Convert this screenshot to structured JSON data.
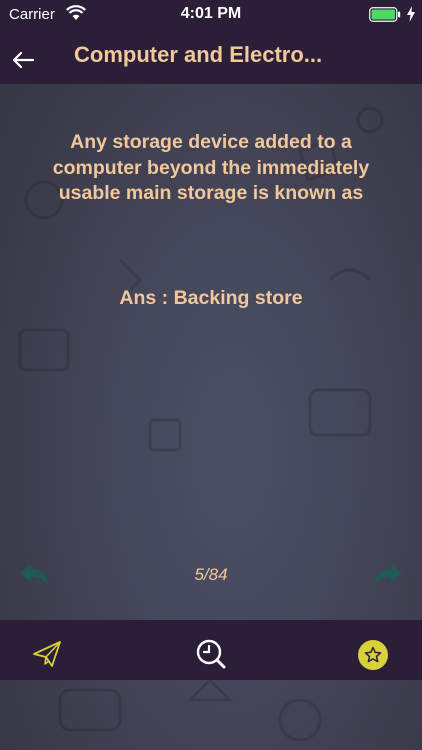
{
  "status_bar": {
    "carrier": "Carrier",
    "time": "4:01 PM"
  },
  "header": {
    "title": "Computer and Electro..."
  },
  "card": {
    "question": "Any storage device added to a computer beyond the immediately usable main storage is known as",
    "answer": "Ans : Backing store"
  },
  "navigation": {
    "page_counter": "5/84"
  },
  "icons": {
    "back": "left-arrow-icon",
    "prev": "reply-arrow-icon",
    "next": "forward-arrow-icon",
    "share": "paper-plane-icon",
    "quiz": "clock-search-icon",
    "favorite": "star-icon"
  },
  "colors": {
    "bar_background": "#2a1f36",
    "text_accent": "#f2c79c",
    "nav_arrow": "#1f5a55",
    "favorite_badge": "#d8d23a",
    "share_icon": "#d8d23a"
  }
}
